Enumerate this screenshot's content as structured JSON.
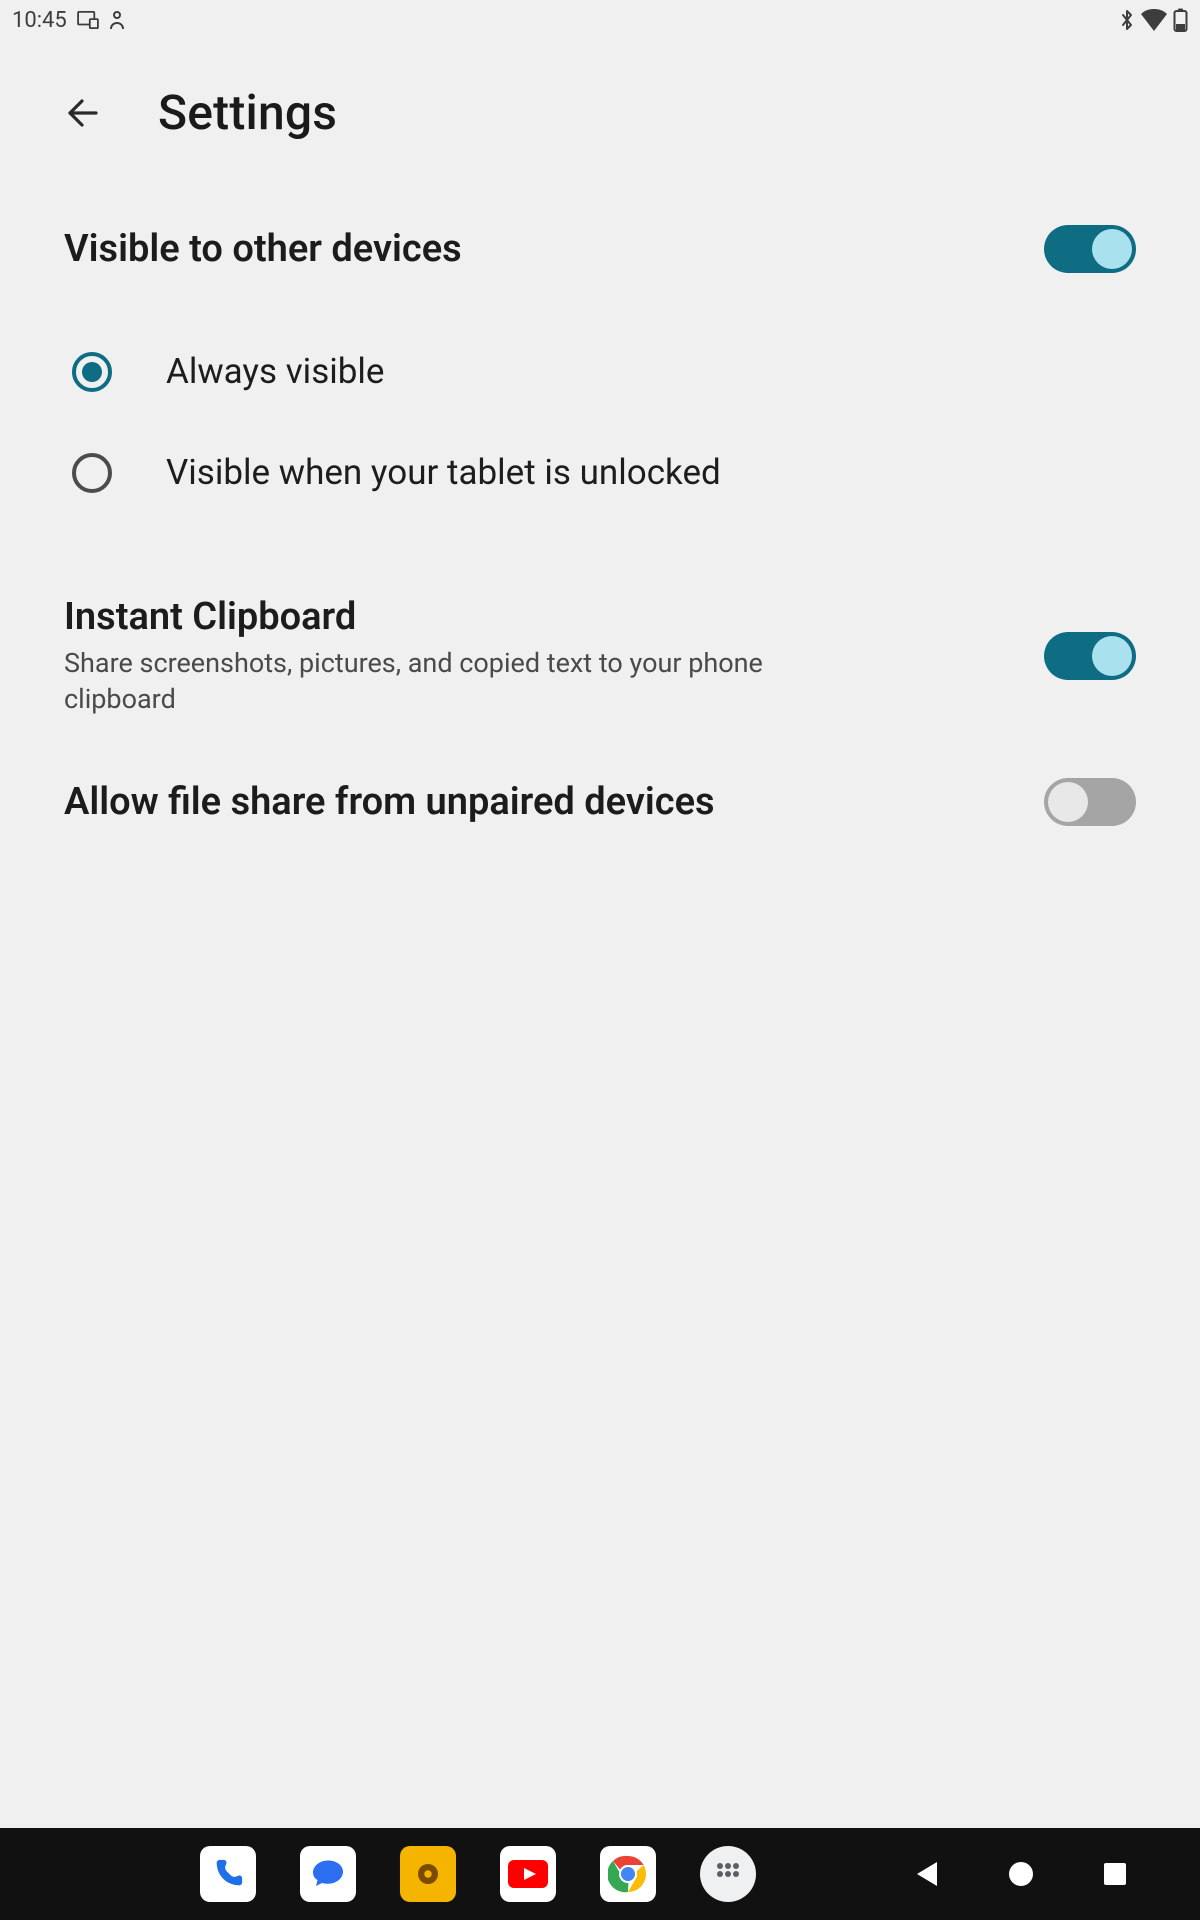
{
  "status": {
    "time": "10:45"
  },
  "header": {
    "title": "Settings"
  },
  "visibility": {
    "title": "Visible to other devices",
    "toggle_on": true,
    "options": [
      {
        "label": "Always visible",
        "selected": true
      },
      {
        "label": "Visible when your tablet is unlocked",
        "selected": false
      }
    ]
  },
  "clipboard": {
    "title": "Instant Clipboard",
    "subtitle": "Share screenshots, pictures, and copied text to your phone clipboard",
    "toggle_on": true
  },
  "unpaired": {
    "title": "Allow file share from unpaired devices",
    "toggle_on": false
  },
  "taskbar": {
    "apps": [
      "phone",
      "messages",
      "camera",
      "youtube",
      "chrome",
      "app-drawer"
    ]
  }
}
